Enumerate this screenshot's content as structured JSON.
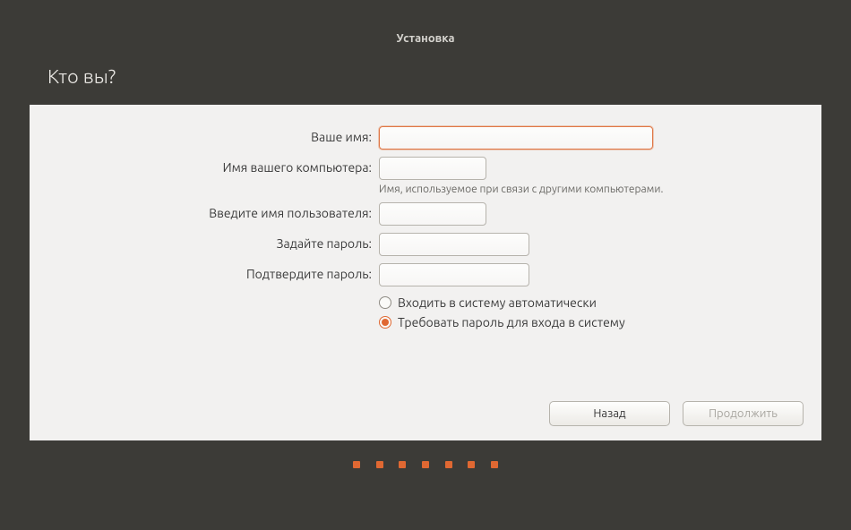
{
  "titlebar": {
    "title": "Установка"
  },
  "header": {
    "title": "Кто вы?"
  },
  "form": {
    "name_label": "Ваше имя:",
    "name_value": "",
    "hostname_label": "Имя вашего компьютера:",
    "hostname_value": "",
    "hostname_hint": "Имя, используемое при связи с другими компьютерами.",
    "username_label": "Введите имя пользователя:",
    "username_value": "",
    "password_label": "Задайте пароль:",
    "password_value": "",
    "confirm_label": "Подтвердите пароль:",
    "confirm_value": "",
    "radio_auto": "Входить в систему автоматически",
    "radio_require": "Требовать пароль для входа в систему",
    "radio_selected": "require"
  },
  "buttons": {
    "back": "Назад",
    "continue": "Продолжить"
  },
  "progress": {
    "dots": 7
  }
}
